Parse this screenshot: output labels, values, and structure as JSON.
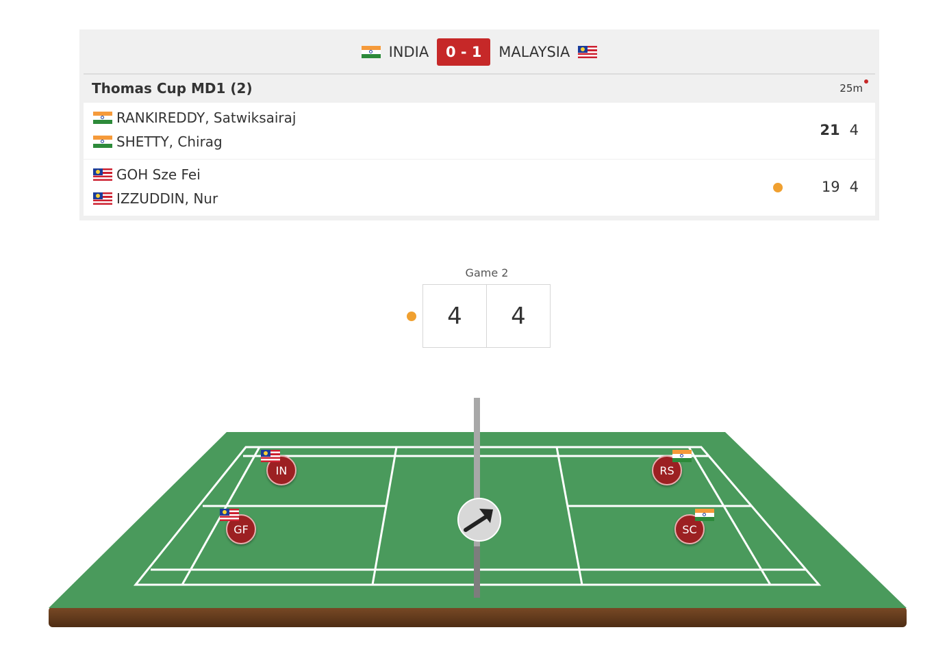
{
  "tie": {
    "home_team": "INDIA",
    "home_flag": "india-flag",
    "score": "0 - 1",
    "away_team": "MALAYSIA",
    "away_flag": "malaysia-flag"
  },
  "match": {
    "title": "Thomas Cup MD1 (2)",
    "duration": "25m",
    "teams": [
      {
        "players": [
          {
            "name": "RANKIREDDY, Satwiksairaj",
            "flag": "india-flag"
          },
          {
            "name": "SHETTY, Chirag",
            "flag": "india-flag"
          }
        ],
        "game1": "21",
        "game2": "4",
        "game1_won": true,
        "serving": false
      },
      {
        "players": [
          {
            "name": "GOH Sze Fei",
            "flag": "malaysia-flag"
          },
          {
            "name": "IZZUDDIN, Nur",
            "flag": "malaysia-flag"
          }
        ],
        "game1": "19",
        "game2": "4",
        "game1_won": false,
        "serving": true
      }
    ]
  },
  "current_game": {
    "label": "Game 2",
    "left_score": "4",
    "right_score": "4",
    "serving_side": "left"
  },
  "court": {
    "colors": {
      "floor": "#4a9a5c",
      "lines": "#ffffff",
      "base": "#6b4022",
      "net": "#a0a0a0",
      "token": "#9c2022"
    },
    "shuttle_icon": "diagonal-arrow-icon",
    "players_on_court": [
      {
        "initials": "IN",
        "flag": "malaysia-flag"
      },
      {
        "initials": "GF",
        "flag": "malaysia-flag"
      },
      {
        "initials": "RS",
        "flag": "india-flag"
      },
      {
        "initials": "SC",
        "flag": "india-flag"
      }
    ]
  }
}
